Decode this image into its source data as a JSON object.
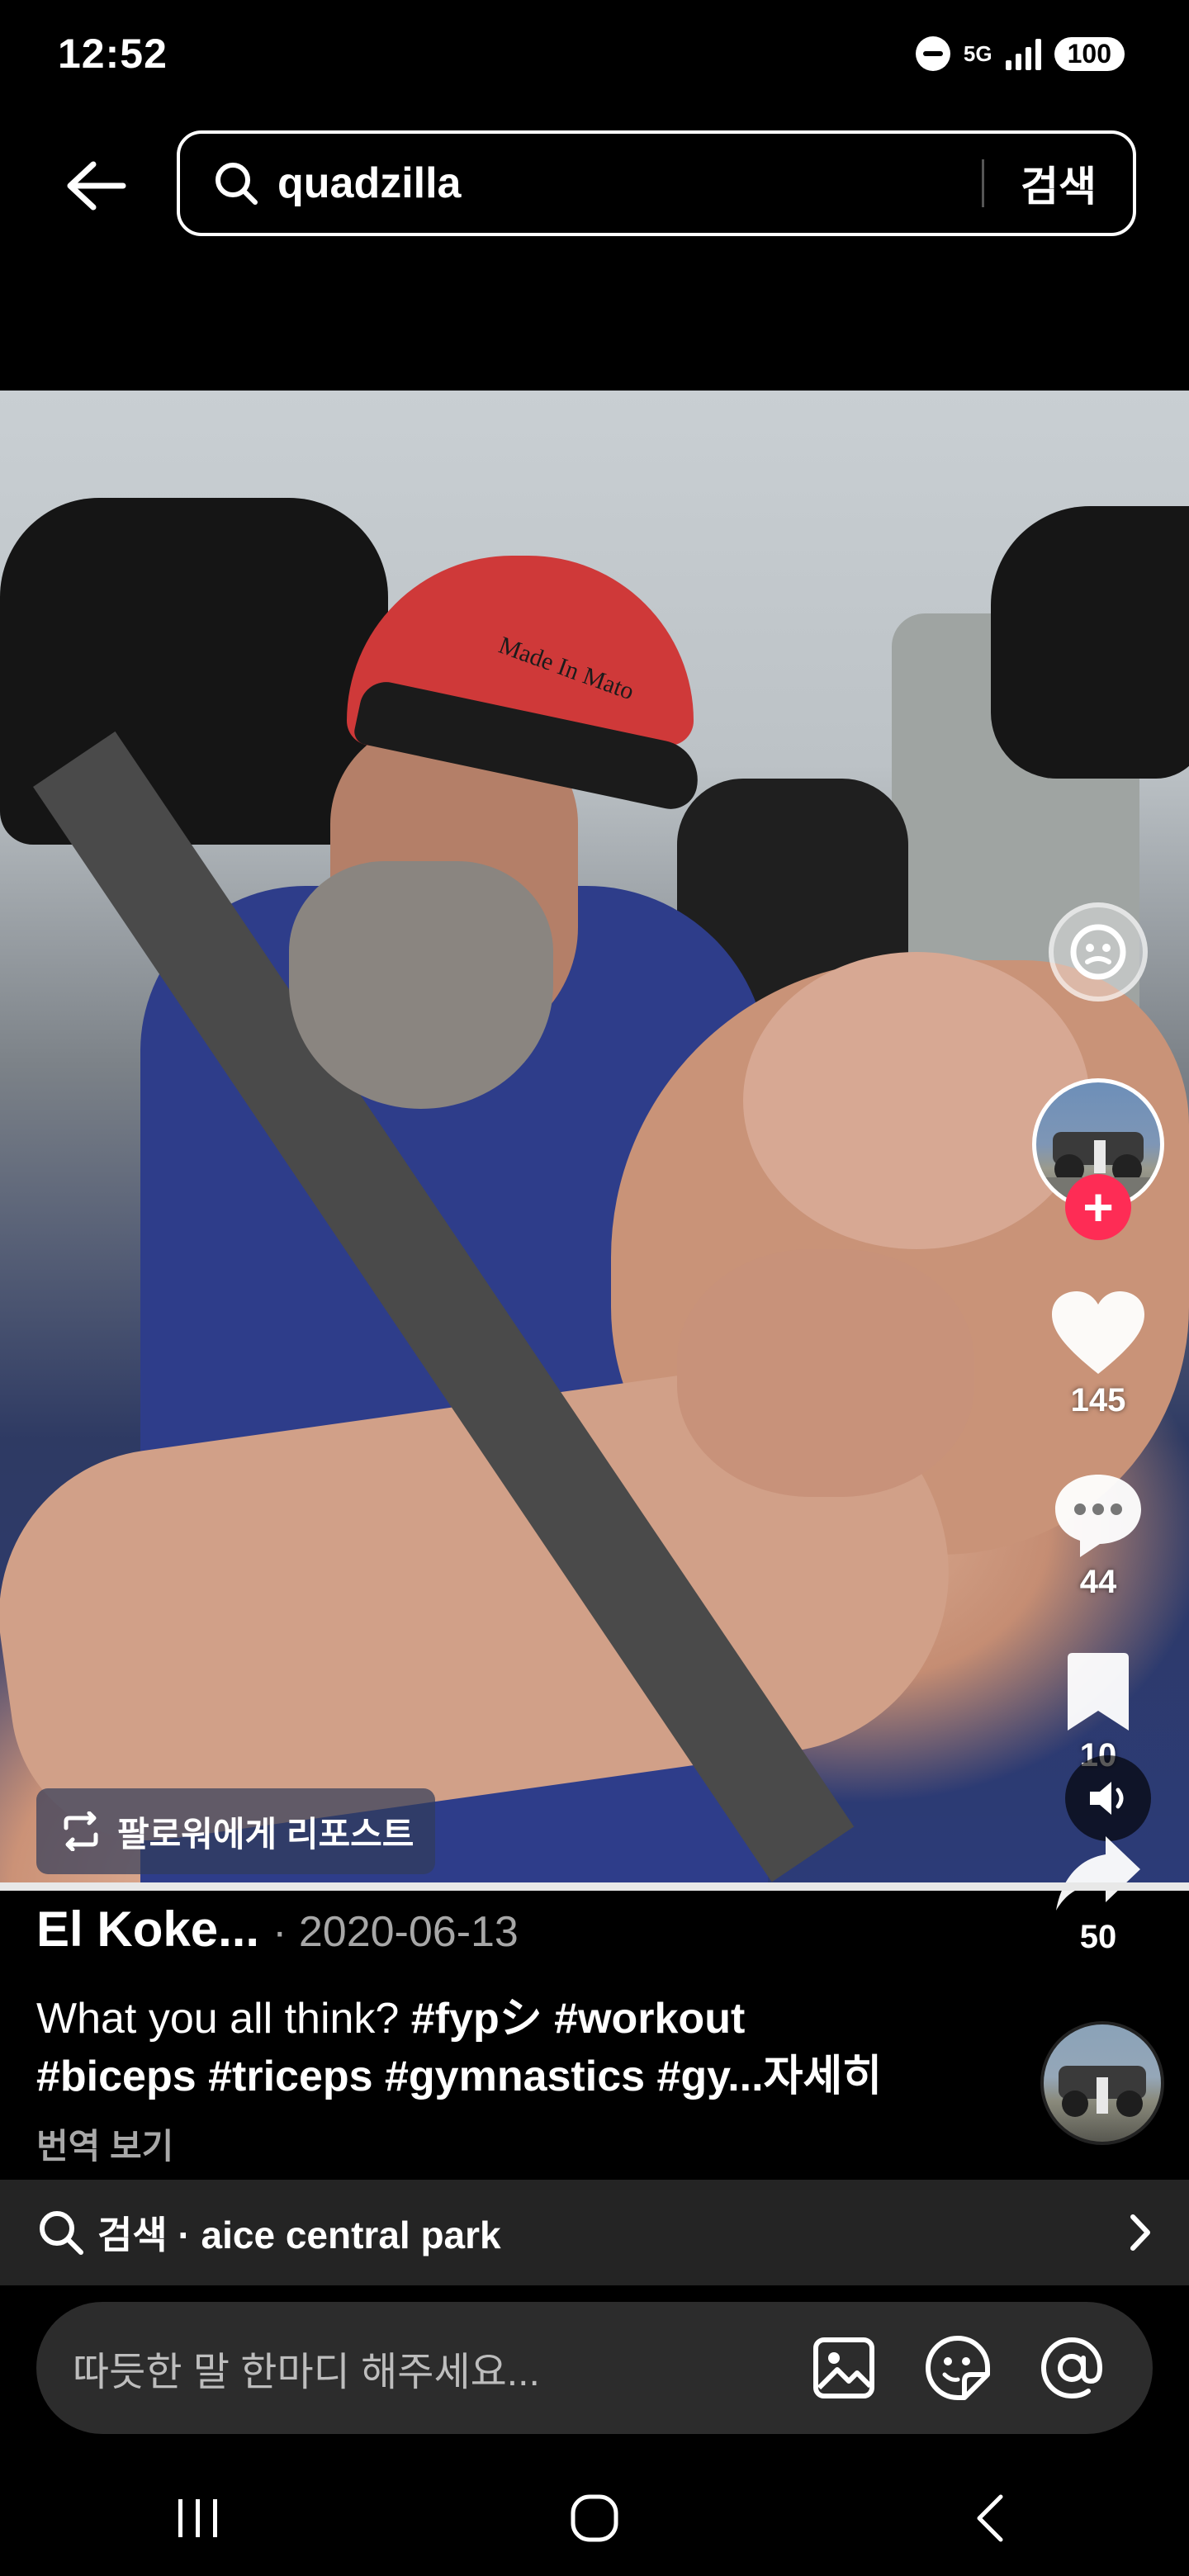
{
  "status_bar": {
    "time": "12:52",
    "network": "5G",
    "battery": "100"
  },
  "search": {
    "query": "quadzilla",
    "submit_label": "검색"
  },
  "video": {
    "cap_text": "Made In Mato",
    "repost_label": "팔로워에게 리포스트"
  },
  "actions": {
    "likes": "145",
    "comments": "44",
    "bookmarks": "10",
    "shares": "50"
  },
  "post": {
    "author": "El Koke...",
    "date": "· 2020-06-13",
    "caption_plain": "What you all think? ",
    "caption_tags_line1": "#fypシ #workout",
    "caption_tags_line2": "#biceps #triceps #gymnastics #gy...",
    "caption_more": "자세히",
    "translate_label": "번역 보기"
  },
  "related_search": {
    "text": "검색 · aice central park"
  },
  "comment_bar": {
    "placeholder": "따듯한 말 한마디 해주세요..."
  },
  "colors": {
    "accent": "#fe2c55",
    "background": "#000000"
  },
  "icons": [
    "back-arrow-icon",
    "search-icon",
    "emoji-effect-icon",
    "heart-icon",
    "comment-icon",
    "bookmark-icon",
    "share-icon",
    "volume-icon",
    "repost-icon",
    "chevron-right-icon",
    "image-icon",
    "sticker-icon",
    "mention-icon"
  ]
}
